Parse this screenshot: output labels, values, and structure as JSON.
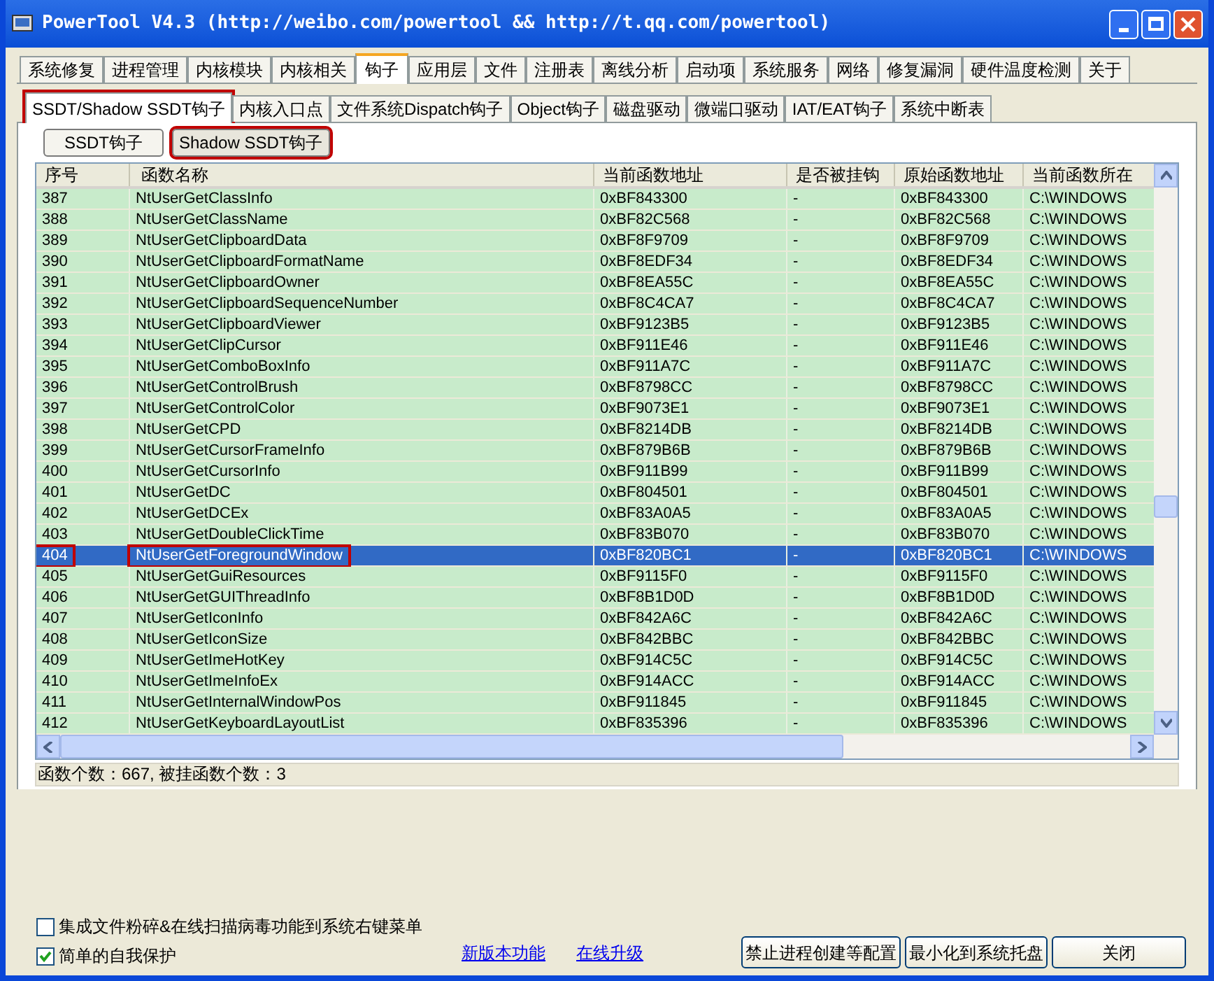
{
  "window": {
    "title": "PowerTool V4.3 (http://weibo.com/powertool && http://t.qq.com/powertool)"
  },
  "tabs": [
    {
      "label": "系统修复",
      "selected": false
    },
    {
      "label": "进程管理",
      "selected": false
    },
    {
      "label": "内核模块",
      "selected": false
    },
    {
      "label": "内核相关",
      "selected": false
    },
    {
      "label": "钩子",
      "selected": true
    },
    {
      "label": "应用层",
      "selected": false
    },
    {
      "label": "文件",
      "selected": false
    },
    {
      "label": "注册表",
      "selected": false
    },
    {
      "label": "离线分析",
      "selected": false
    },
    {
      "label": "启动项",
      "selected": false
    },
    {
      "label": "系统服务",
      "selected": false
    },
    {
      "label": "网络",
      "selected": false
    },
    {
      "label": "修复漏洞",
      "selected": false
    },
    {
      "label": "硬件温度检测",
      "selected": false
    },
    {
      "label": "关于",
      "selected": false
    }
  ],
  "subtabs": [
    {
      "label": "SSDT/Shadow SSDT钩子",
      "selected": true,
      "marked": true
    },
    {
      "label": "内核入口点",
      "selected": false,
      "marked": false
    },
    {
      "label": "文件系统Dispatch钩子",
      "selected": false,
      "marked": false
    },
    {
      "label": "Object钩子",
      "selected": false,
      "marked": false
    },
    {
      "label": "磁盘驱动",
      "selected": false,
      "marked": false
    },
    {
      "label": "微端口驱动",
      "selected": false,
      "marked": false
    },
    {
      "label": "IAT/EAT钩子",
      "selected": false,
      "marked": false
    },
    {
      "label": "系统中断表",
      "selected": false,
      "marked": false
    }
  ],
  "mode_buttons": [
    {
      "label": "SSDT钩子",
      "selected": false,
      "marked": false
    },
    {
      "label": "Shadow SSDT钩子",
      "selected": true,
      "marked": true
    }
  ],
  "table": {
    "columns": [
      "序号",
      "函数名称",
      "当前函数地址",
      "是否被挂钩",
      "原始函数地址",
      "当前函数所在"
    ],
    "rows": [
      {
        "cells": [
          "387",
          "NtUserGetClassInfo",
          "0xBF843300",
          "-",
          "0xBF843300",
          "C:\\WINDOWS"
        ],
        "selected": false,
        "marked": false
      },
      {
        "cells": [
          "388",
          "NtUserGetClassName",
          "0xBF82C568",
          "-",
          "0xBF82C568",
          "C:\\WINDOWS"
        ],
        "selected": false,
        "marked": false
      },
      {
        "cells": [
          "389",
          "NtUserGetClipboardData",
          "0xBF8F9709",
          "-",
          "0xBF8F9709",
          "C:\\WINDOWS"
        ],
        "selected": false,
        "marked": false
      },
      {
        "cells": [
          "390",
          "NtUserGetClipboardFormatName",
          "0xBF8EDF34",
          "-",
          "0xBF8EDF34",
          "C:\\WINDOWS"
        ],
        "selected": false,
        "marked": false
      },
      {
        "cells": [
          "391",
          "NtUserGetClipboardOwner",
          "0xBF8EA55C",
          "-",
          "0xBF8EA55C",
          "C:\\WINDOWS"
        ],
        "selected": false,
        "marked": false
      },
      {
        "cells": [
          "392",
          "NtUserGetClipboardSequenceNumber",
          "0xBF8C4CA7",
          "-",
          "0xBF8C4CA7",
          "C:\\WINDOWS"
        ],
        "selected": false,
        "marked": false
      },
      {
        "cells": [
          "393",
          "NtUserGetClipboardViewer",
          "0xBF9123B5",
          "-",
          "0xBF9123B5",
          "C:\\WINDOWS"
        ],
        "selected": false,
        "marked": false
      },
      {
        "cells": [
          "394",
          "NtUserGetClipCursor",
          "0xBF911E46",
          "-",
          "0xBF911E46",
          "C:\\WINDOWS"
        ],
        "selected": false,
        "marked": false
      },
      {
        "cells": [
          "395",
          "NtUserGetComboBoxInfo",
          "0xBF911A7C",
          "-",
          "0xBF911A7C",
          "C:\\WINDOWS"
        ],
        "selected": false,
        "marked": false
      },
      {
        "cells": [
          "396",
          "NtUserGetControlBrush",
          "0xBF8798CC",
          "-",
          "0xBF8798CC",
          "C:\\WINDOWS"
        ],
        "selected": false,
        "marked": false
      },
      {
        "cells": [
          "397",
          "NtUserGetControlColor",
          "0xBF9073E1",
          "-",
          "0xBF9073E1",
          "C:\\WINDOWS"
        ],
        "selected": false,
        "marked": false
      },
      {
        "cells": [
          "398",
          "NtUserGetCPD",
          "0xBF8214DB",
          "-",
          "0xBF8214DB",
          "C:\\WINDOWS"
        ],
        "selected": false,
        "marked": false
      },
      {
        "cells": [
          "399",
          "NtUserGetCursorFrameInfo",
          "0xBF879B6B",
          "-",
          "0xBF879B6B",
          "C:\\WINDOWS"
        ],
        "selected": false,
        "marked": false
      },
      {
        "cells": [
          "400",
          "NtUserGetCursorInfo",
          "0xBF911B99",
          "-",
          "0xBF911B99",
          "C:\\WINDOWS"
        ],
        "selected": false,
        "marked": false
      },
      {
        "cells": [
          "401",
          "NtUserGetDC",
          "0xBF804501",
          "-",
          "0xBF804501",
          "C:\\WINDOWS"
        ],
        "selected": false,
        "marked": false
      },
      {
        "cells": [
          "402",
          "NtUserGetDCEx",
          "0xBF83A0A5",
          "-",
          "0xBF83A0A5",
          "C:\\WINDOWS"
        ],
        "selected": false,
        "marked": false
      },
      {
        "cells": [
          "403",
          "NtUserGetDoubleClickTime",
          "0xBF83B070",
          "-",
          "0xBF83B070",
          "C:\\WINDOWS"
        ],
        "selected": false,
        "marked": false
      },
      {
        "cells": [
          "404",
          "NtUserGetForegroundWindow",
          "0xBF820BC1",
          "-",
          "0xBF820BC1",
          "C:\\WINDOWS"
        ],
        "selected": true,
        "marked": true
      },
      {
        "cells": [
          "405",
          "NtUserGetGuiResources",
          "0xBF9115F0",
          "-",
          "0xBF9115F0",
          "C:\\WINDOWS"
        ],
        "selected": false,
        "marked": false
      },
      {
        "cells": [
          "406",
          "NtUserGetGUIThreadInfo",
          "0xBF8B1D0D",
          "-",
          "0xBF8B1D0D",
          "C:\\WINDOWS"
        ],
        "selected": false,
        "marked": false
      },
      {
        "cells": [
          "407",
          "NtUserGetIconInfo",
          "0xBF842A6C",
          "-",
          "0xBF842A6C",
          "C:\\WINDOWS"
        ],
        "selected": false,
        "marked": false
      },
      {
        "cells": [
          "408",
          "NtUserGetIconSize",
          "0xBF842BBC",
          "-",
          "0xBF842BBC",
          "C:\\WINDOWS"
        ],
        "selected": false,
        "marked": false
      },
      {
        "cells": [
          "409",
          "NtUserGetImeHotKey",
          "0xBF914C5C",
          "-",
          "0xBF914C5C",
          "C:\\WINDOWS"
        ],
        "selected": false,
        "marked": false
      },
      {
        "cells": [
          "410",
          "NtUserGetImeInfoEx",
          "0xBF914ACC",
          "-",
          "0xBF914ACC",
          "C:\\WINDOWS"
        ],
        "selected": false,
        "marked": false
      },
      {
        "cells": [
          "411",
          "NtUserGetInternalWindowPos",
          "0xBF911845",
          "-",
          "0xBF911845",
          "C:\\WINDOWS"
        ],
        "selected": false,
        "marked": false
      },
      {
        "cells": [
          "412",
          "NtUserGetKeyboardLayoutList",
          "0xBF835396",
          "-",
          "0xBF835396",
          "C:\\WINDOWS"
        ],
        "selected": false,
        "marked": false
      }
    ]
  },
  "status_bar": "函数个数：667, 被挂函数个数：3",
  "options": [
    {
      "label": "集成文件粉碎&在线扫描病毒功能到系统右键菜单",
      "checked": false
    },
    {
      "label": "简单的自我保护",
      "checked": true
    }
  ],
  "links": [
    "新版本功能",
    "在线升级"
  ],
  "buttons": [
    "禁止进程创建等配置",
    "最小化到系统托盘",
    "关闭"
  ]
}
